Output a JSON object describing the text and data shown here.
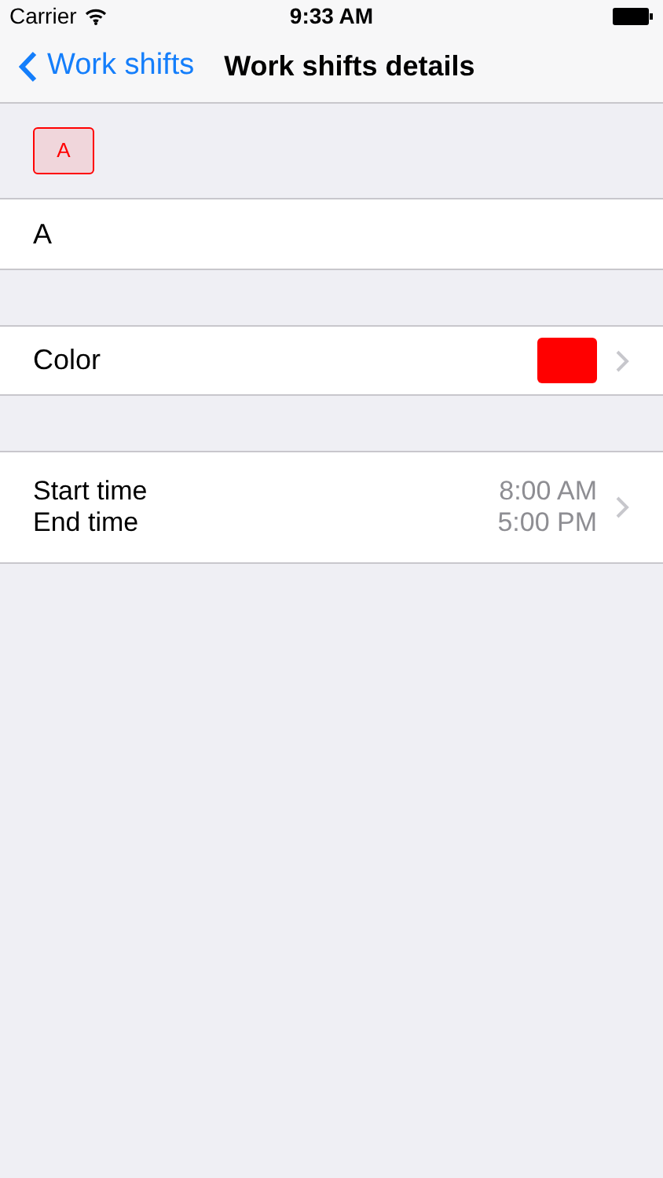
{
  "status_bar": {
    "carrier": "Carrier",
    "time": "9:33 AM"
  },
  "nav": {
    "back": "Work shifts",
    "title": "Work shifts details"
  },
  "badge": {
    "label": "A",
    "color": "#ff0000"
  },
  "name_field": {
    "value": "A"
  },
  "color_row": {
    "label": "Color",
    "color": "#ff0000"
  },
  "time_row": {
    "start_label": "Start time",
    "end_label": "End time",
    "start": "8:00 AM",
    "end": "5:00 PM"
  }
}
